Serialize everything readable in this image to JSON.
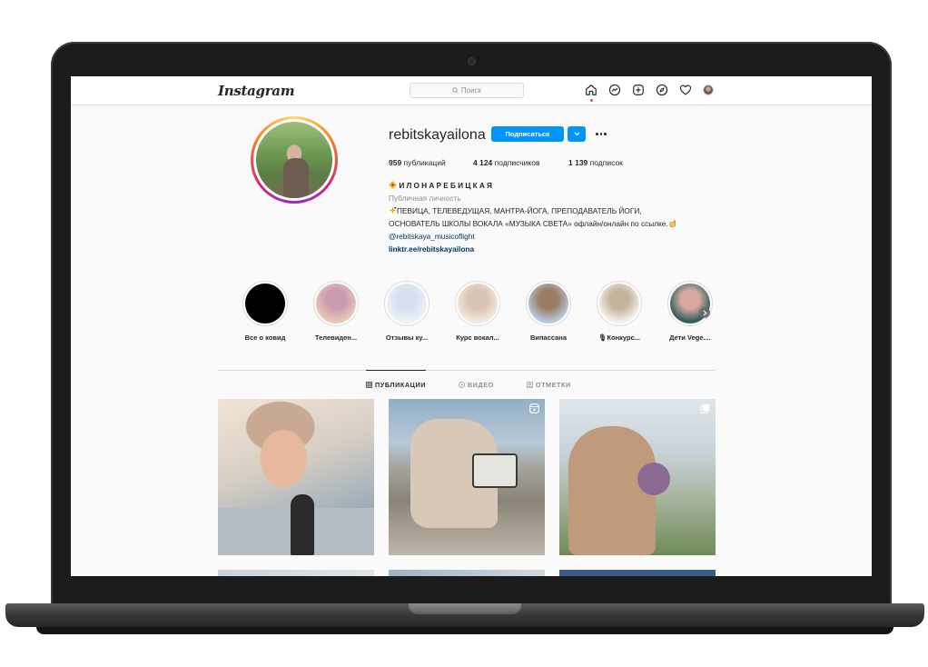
{
  "app": {
    "logo": "Instagram",
    "search_placeholder": "Поиск"
  },
  "nav": {
    "icons": [
      "home-icon",
      "messenger-icon",
      "new-post-icon",
      "explore-icon",
      "activity-heart-icon",
      "profile-avatar"
    ]
  },
  "profile": {
    "username": "rebitskayailona",
    "follow_label": "Подписаться",
    "stats": {
      "posts_count": "959",
      "posts_label": " публикаций",
      "followers_count": "4 124",
      "followers_label": " подписчиков",
      "following_count": "1 139",
      "following_label": " подписок"
    },
    "full_name": "ИЛОНАРЕБИЦКАЯ",
    "category": "Публичная личность",
    "bio_line_1": "ПЕВИЦА, ТЕЛЕВЕДУЩАЯ, МАНТРА-ЙОГА, ПРЕПОДАВАТЕЛЬ ЙОГИ,",
    "bio_line_2": "ОСНОВАТЕЛЬ ШКОЛЫ ВОКАЛА «МУЗЫКА СВЕТА» офлайн/онлайн по ссылке.",
    "mention": "@rebitskaya_musicoflight",
    "link": "linktr.ee/rebitskayailona"
  },
  "highlights": [
    {
      "label": "Все о ковид",
      "color_a": "#000000",
      "color_b": "#000000"
    },
    {
      "label": "Телевиден...",
      "color_a": "#e8c9b6",
      "color_b": "#c99ab0"
    },
    {
      "label": "Отзывы ку...",
      "color_a": "#eef1f6",
      "color_b": "#d7dff0"
    },
    {
      "label": "Курс вокал...",
      "color_a": "#f3e6dc",
      "color_b": "#d9c3b4"
    },
    {
      "label": "Випассана",
      "color_a": "#b7c8dc",
      "color_b": "#9a7c62"
    },
    {
      "label": "🎙Конкурс...",
      "color_a": "#f2efe8",
      "color_b": "#c4b49d"
    },
    {
      "label": "Дети Vege....",
      "color_a": "#2f5f5a",
      "color_b": "#d7a9a0"
    }
  ],
  "tabs": [
    {
      "label": "ПУБЛИКАЦИИ",
      "active": true
    },
    {
      "label": "ВИДЕО",
      "active": false
    },
    {
      "label": "ОТМЕТКИ",
      "active": false
    }
  ],
  "colors": {
    "accent": "#0095f6",
    "text": "#262626",
    "muted": "#8e8e8e",
    "link": "#00376b",
    "border": "#dbdbdb"
  }
}
